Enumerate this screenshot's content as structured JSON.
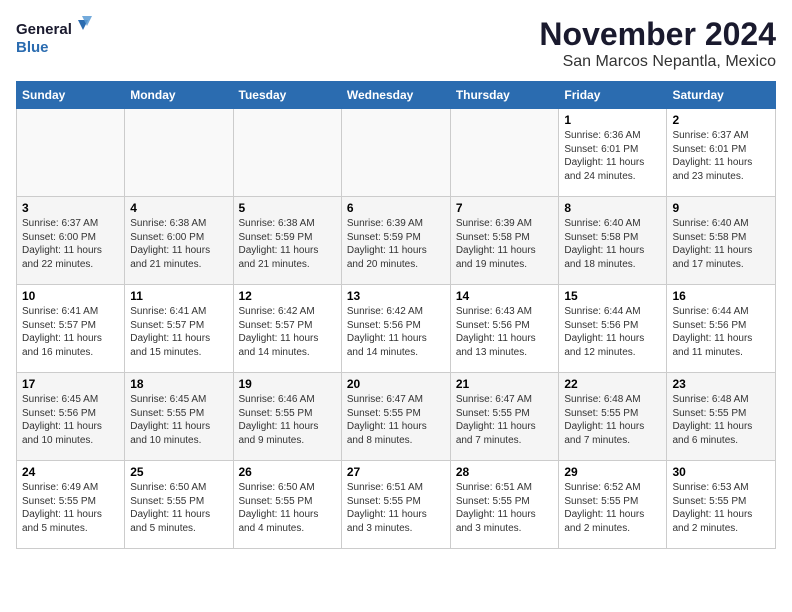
{
  "logo": {
    "line1": "General",
    "line2": "Blue"
  },
  "title": "November 2024",
  "subtitle": "San Marcos Nepantla, Mexico",
  "days_of_week": [
    "Sunday",
    "Monday",
    "Tuesday",
    "Wednesday",
    "Thursday",
    "Friday",
    "Saturday"
  ],
  "weeks": [
    [
      {
        "day": "",
        "info": ""
      },
      {
        "day": "",
        "info": ""
      },
      {
        "day": "",
        "info": ""
      },
      {
        "day": "",
        "info": ""
      },
      {
        "day": "",
        "info": ""
      },
      {
        "day": "1",
        "info": "Sunrise: 6:36 AM\nSunset: 6:01 PM\nDaylight: 11 hours and 24 minutes."
      },
      {
        "day": "2",
        "info": "Sunrise: 6:37 AM\nSunset: 6:01 PM\nDaylight: 11 hours and 23 minutes."
      }
    ],
    [
      {
        "day": "3",
        "info": "Sunrise: 6:37 AM\nSunset: 6:00 PM\nDaylight: 11 hours and 22 minutes."
      },
      {
        "day": "4",
        "info": "Sunrise: 6:38 AM\nSunset: 6:00 PM\nDaylight: 11 hours and 21 minutes."
      },
      {
        "day": "5",
        "info": "Sunrise: 6:38 AM\nSunset: 5:59 PM\nDaylight: 11 hours and 21 minutes."
      },
      {
        "day": "6",
        "info": "Sunrise: 6:39 AM\nSunset: 5:59 PM\nDaylight: 11 hours and 20 minutes."
      },
      {
        "day": "7",
        "info": "Sunrise: 6:39 AM\nSunset: 5:58 PM\nDaylight: 11 hours and 19 minutes."
      },
      {
        "day": "8",
        "info": "Sunrise: 6:40 AM\nSunset: 5:58 PM\nDaylight: 11 hours and 18 minutes."
      },
      {
        "day": "9",
        "info": "Sunrise: 6:40 AM\nSunset: 5:58 PM\nDaylight: 11 hours and 17 minutes."
      }
    ],
    [
      {
        "day": "10",
        "info": "Sunrise: 6:41 AM\nSunset: 5:57 PM\nDaylight: 11 hours and 16 minutes."
      },
      {
        "day": "11",
        "info": "Sunrise: 6:41 AM\nSunset: 5:57 PM\nDaylight: 11 hours and 15 minutes."
      },
      {
        "day": "12",
        "info": "Sunrise: 6:42 AM\nSunset: 5:57 PM\nDaylight: 11 hours and 14 minutes."
      },
      {
        "day": "13",
        "info": "Sunrise: 6:42 AM\nSunset: 5:56 PM\nDaylight: 11 hours and 14 minutes."
      },
      {
        "day": "14",
        "info": "Sunrise: 6:43 AM\nSunset: 5:56 PM\nDaylight: 11 hours and 13 minutes."
      },
      {
        "day": "15",
        "info": "Sunrise: 6:44 AM\nSunset: 5:56 PM\nDaylight: 11 hours and 12 minutes."
      },
      {
        "day": "16",
        "info": "Sunrise: 6:44 AM\nSunset: 5:56 PM\nDaylight: 11 hours and 11 minutes."
      }
    ],
    [
      {
        "day": "17",
        "info": "Sunrise: 6:45 AM\nSunset: 5:56 PM\nDaylight: 11 hours and 10 minutes."
      },
      {
        "day": "18",
        "info": "Sunrise: 6:45 AM\nSunset: 5:55 PM\nDaylight: 11 hours and 10 minutes."
      },
      {
        "day": "19",
        "info": "Sunrise: 6:46 AM\nSunset: 5:55 PM\nDaylight: 11 hours and 9 minutes."
      },
      {
        "day": "20",
        "info": "Sunrise: 6:47 AM\nSunset: 5:55 PM\nDaylight: 11 hours and 8 minutes."
      },
      {
        "day": "21",
        "info": "Sunrise: 6:47 AM\nSunset: 5:55 PM\nDaylight: 11 hours and 7 minutes."
      },
      {
        "day": "22",
        "info": "Sunrise: 6:48 AM\nSunset: 5:55 PM\nDaylight: 11 hours and 7 minutes."
      },
      {
        "day": "23",
        "info": "Sunrise: 6:48 AM\nSunset: 5:55 PM\nDaylight: 11 hours and 6 minutes."
      }
    ],
    [
      {
        "day": "24",
        "info": "Sunrise: 6:49 AM\nSunset: 5:55 PM\nDaylight: 11 hours and 5 minutes."
      },
      {
        "day": "25",
        "info": "Sunrise: 6:50 AM\nSunset: 5:55 PM\nDaylight: 11 hours and 5 minutes."
      },
      {
        "day": "26",
        "info": "Sunrise: 6:50 AM\nSunset: 5:55 PM\nDaylight: 11 hours and 4 minutes."
      },
      {
        "day": "27",
        "info": "Sunrise: 6:51 AM\nSunset: 5:55 PM\nDaylight: 11 hours and 3 minutes."
      },
      {
        "day": "28",
        "info": "Sunrise: 6:51 AM\nSunset: 5:55 PM\nDaylight: 11 hours and 3 minutes."
      },
      {
        "day": "29",
        "info": "Sunrise: 6:52 AM\nSunset: 5:55 PM\nDaylight: 11 hours and 2 minutes."
      },
      {
        "day": "30",
        "info": "Sunrise: 6:53 AM\nSunset: 5:55 PM\nDaylight: 11 hours and 2 minutes."
      }
    ]
  ]
}
